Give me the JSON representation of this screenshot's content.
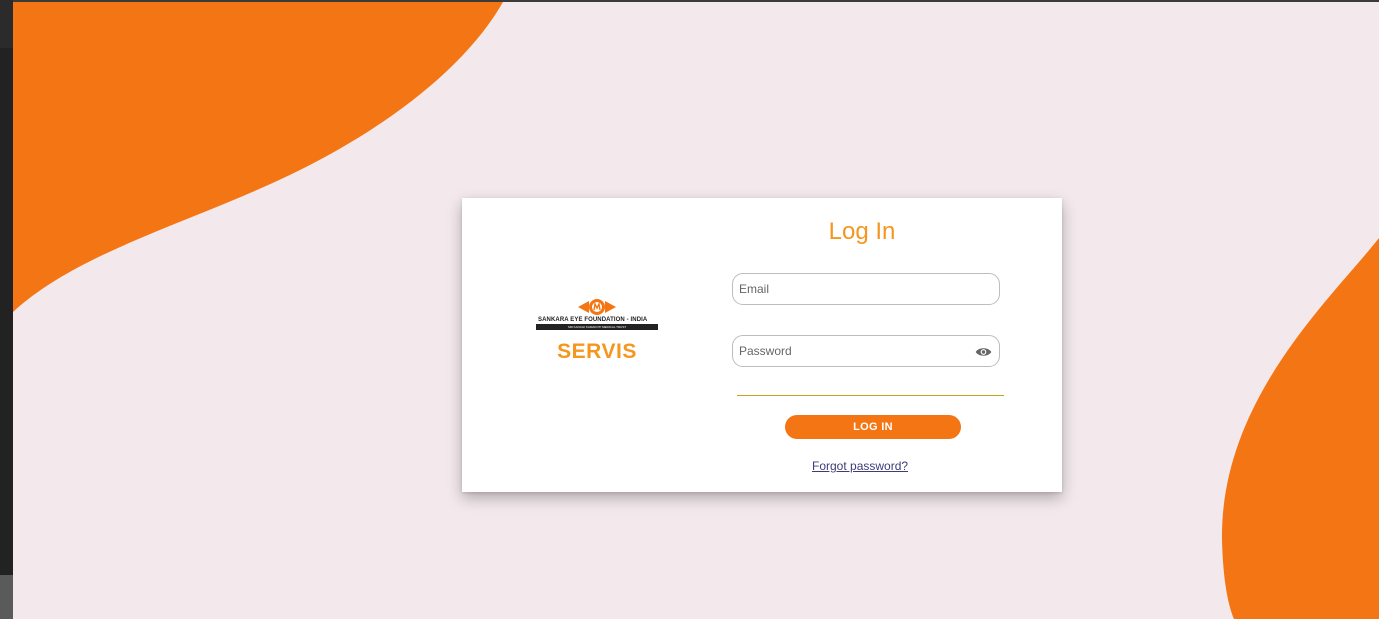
{
  "brand": {
    "org_name": "SANKARA EYE FOUNDATION - INDIA",
    "trust_name": "SRI KANCHI KAMAKOTI MEDICAL TRUST",
    "product_name": "SERVIS"
  },
  "login": {
    "title": "Log In",
    "email_placeholder": "Email",
    "password_placeholder": "Password",
    "submit_label": "LOG IN",
    "forgot_link": "Forgot password?"
  },
  "icons": {
    "password_toggle": "eye-icon",
    "logo": "sankara-eye-emblem"
  },
  "colors": {
    "background": "#f3e9ec",
    "accent_orange": "#f47514",
    "title_orange": "#f5961e",
    "card": "#ffffff"
  }
}
